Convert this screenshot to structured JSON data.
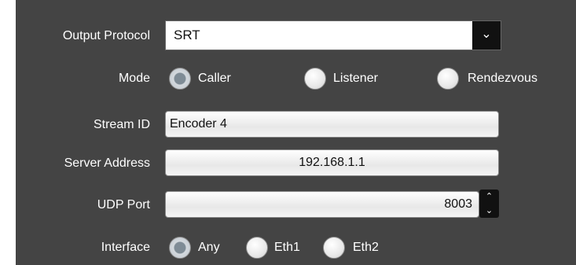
{
  "output_protocol": {
    "label": "Output Protocol",
    "value": "SRT",
    "arrow": "⌄"
  },
  "mode": {
    "label": "Mode",
    "options": [
      "Caller",
      "Listener",
      "Rendezvous"
    ],
    "selected": "Caller"
  },
  "stream_id": {
    "label": "Stream ID",
    "value": "Encoder 4"
  },
  "server_address": {
    "label": "Server Address",
    "value": "192.168.1.1"
  },
  "udp_port": {
    "label": "UDP Port",
    "value": "8003",
    "up": "⌃",
    "down": "⌄"
  },
  "interface": {
    "label": "Interface",
    "options": [
      "Any",
      "Eth1",
      "Eth2"
    ],
    "selected": "Any"
  }
}
